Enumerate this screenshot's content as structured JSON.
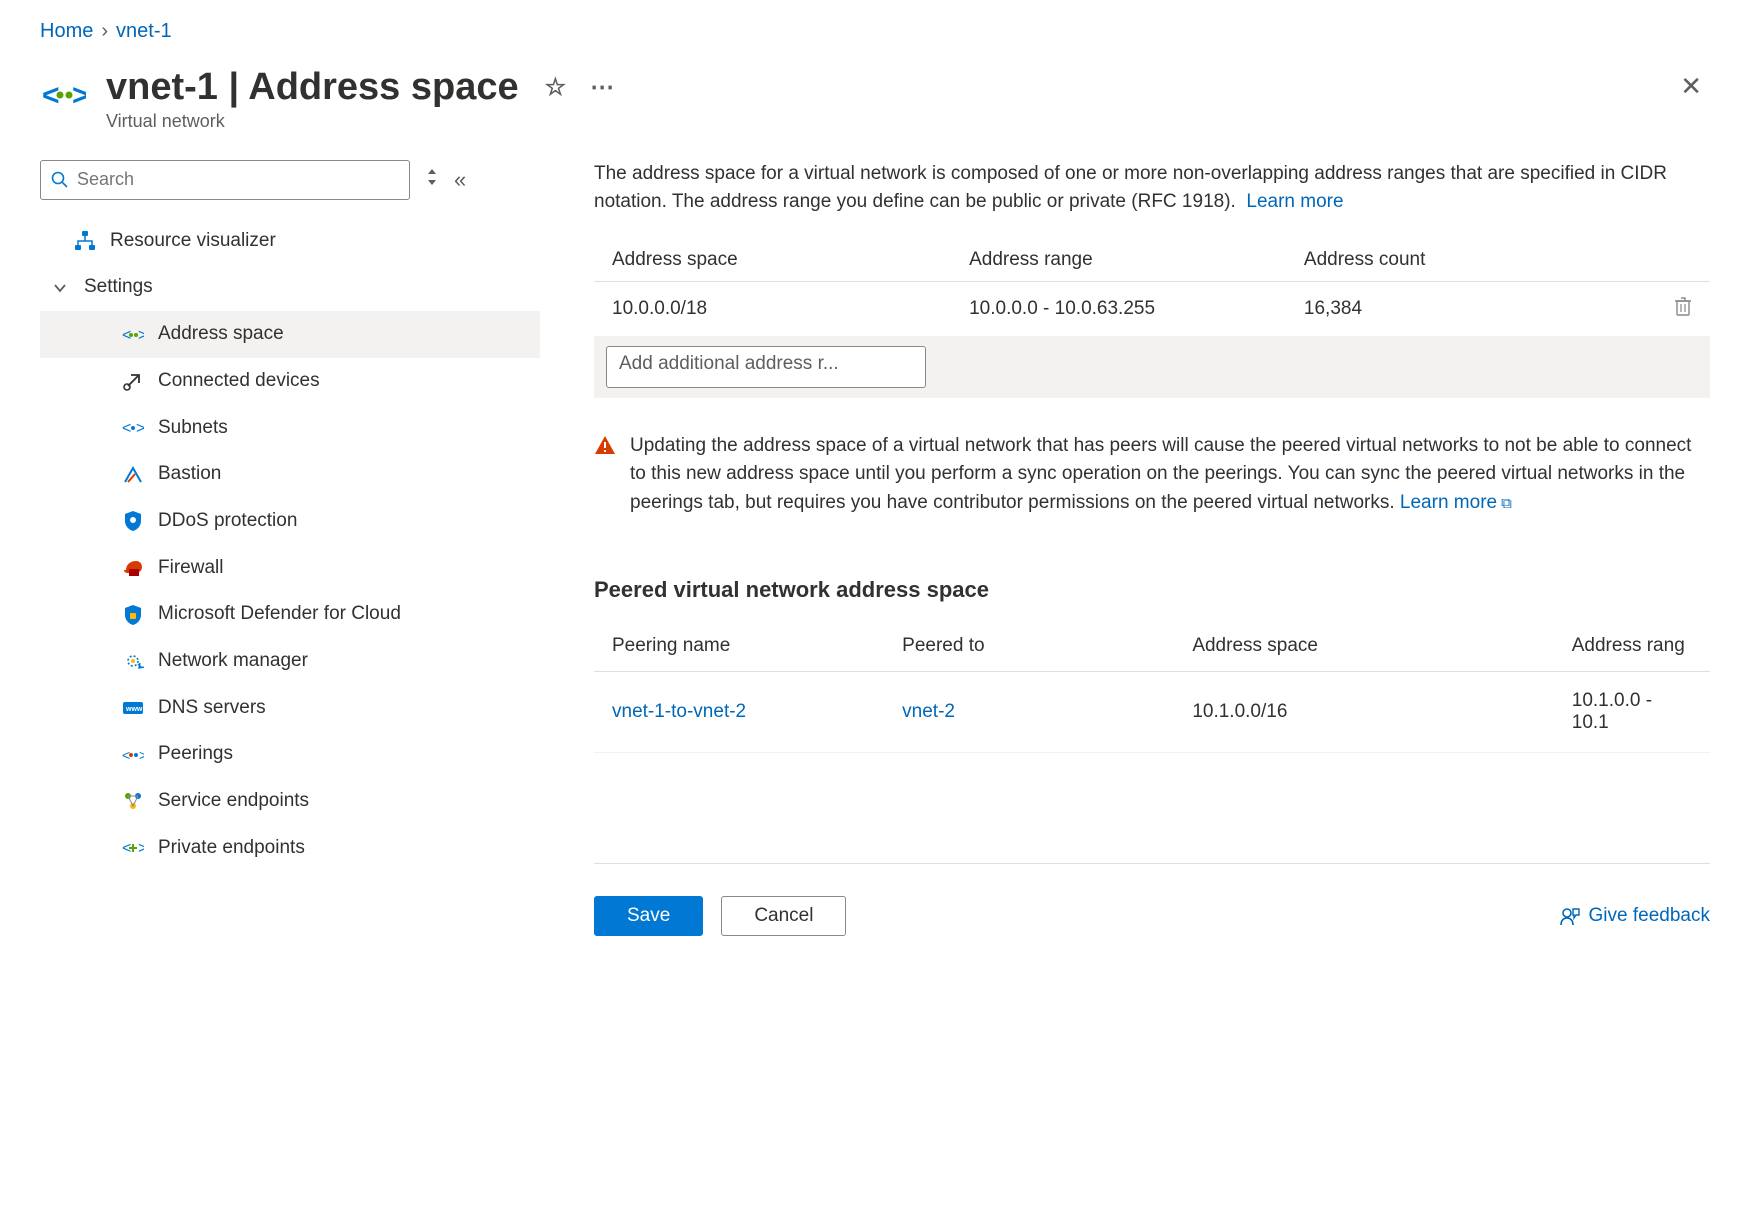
{
  "breadcrumb": [
    {
      "label": "Home"
    },
    {
      "label": "vnet-1"
    }
  ],
  "header": {
    "title": "vnet-1 | Address space",
    "subtitle": "Virtual network"
  },
  "search": {
    "placeholder": "Search"
  },
  "sidebar": {
    "top_item": {
      "label": "Resource visualizer"
    },
    "group_label": "Settings",
    "items": [
      {
        "label": "Address space",
        "name": "address-space",
        "selected": true
      },
      {
        "label": "Connected devices",
        "name": "connected-devices"
      },
      {
        "label": "Subnets",
        "name": "subnets"
      },
      {
        "label": "Bastion",
        "name": "bastion"
      },
      {
        "label": "DDoS protection",
        "name": "ddos-protection"
      },
      {
        "label": "Firewall",
        "name": "firewall"
      },
      {
        "label": "Microsoft Defender for Cloud",
        "name": "defender-for-cloud"
      },
      {
        "label": "Network manager",
        "name": "network-manager"
      },
      {
        "label": "DNS servers",
        "name": "dns-servers"
      },
      {
        "label": "Peerings",
        "name": "peerings"
      },
      {
        "label": "Service endpoints",
        "name": "service-endpoints"
      },
      {
        "label": "Private endpoints",
        "name": "private-endpoints"
      }
    ]
  },
  "main": {
    "intro": "The address space for a virtual network is composed of one or more non-overlapping address ranges that are specified in CIDR notation. The address range you define can be public or private (RFC 1918).",
    "learn_more": "Learn more",
    "addr_headers": {
      "space": "Address space",
      "range": "Address range",
      "count": "Address count"
    },
    "addr_rows": [
      {
        "space": "10.0.0.0/18",
        "range": "10.0.0.0 - 10.0.63.255",
        "count": "16,384"
      }
    ],
    "add_placeholder": "Add additional address r...",
    "warning": "Updating the address space of a virtual network that has peers will cause the peered virtual networks to not be able to connect to this new address space until you perform a sync operation on the peerings. You can sync the peered virtual networks in the peerings tab, but requires you have contributor permissions on the peered virtual networks.",
    "warning_learn_more": "Learn more",
    "peered_title": "Peered virtual network address space",
    "peer_headers": {
      "name": "Peering name",
      "to": "Peered to",
      "space": "Address space",
      "range": "Address rang"
    },
    "peer_rows": [
      {
        "name": "vnet-1-to-vnet-2",
        "to": "vnet-2",
        "space": "10.1.0.0/16",
        "range": "10.1.0.0 - 10.1"
      }
    ]
  },
  "footer": {
    "save": "Save",
    "cancel": "Cancel",
    "feedback": "Give feedback"
  }
}
